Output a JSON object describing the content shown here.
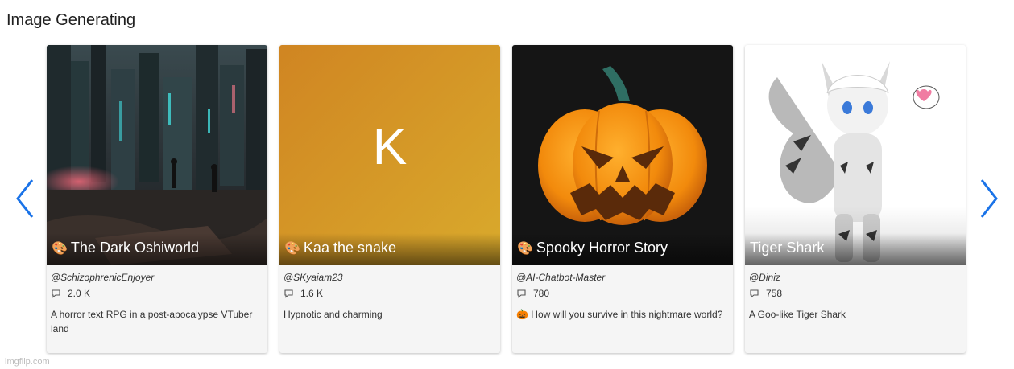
{
  "section": {
    "title": "Image Generating"
  },
  "nav": {
    "prev_icon": "chevron-left-icon",
    "next_icon": "chevron-right-icon",
    "accent": "#1a73e8"
  },
  "cards": [
    {
      "title": "The Dark Oshiworld",
      "title_emoji": "🎨",
      "creator": "@SchizophrenicEnjoyer",
      "chats": "2.0 K",
      "description": "A horror text RPG in a post-apocalypse VTuber land"
    },
    {
      "title": "Kaa the snake",
      "title_emoji": "🎨",
      "avatar_letter": "K",
      "creator": "@SKyaiam23",
      "chats": "1.6 K",
      "description": "Hypnotic and charming"
    },
    {
      "title": "Spooky Horror Story",
      "title_emoji": "🎨",
      "creator": "@AI-Chatbot-Master",
      "chats": "780",
      "description": "🎃 How will you survive in this nightmare world?"
    },
    {
      "title": "Tiger Shark",
      "creator": "@Diniz",
      "chats": "758",
      "description": "A Goo-like Tiger Shark"
    }
  ],
  "watermark": "imgflip.com"
}
